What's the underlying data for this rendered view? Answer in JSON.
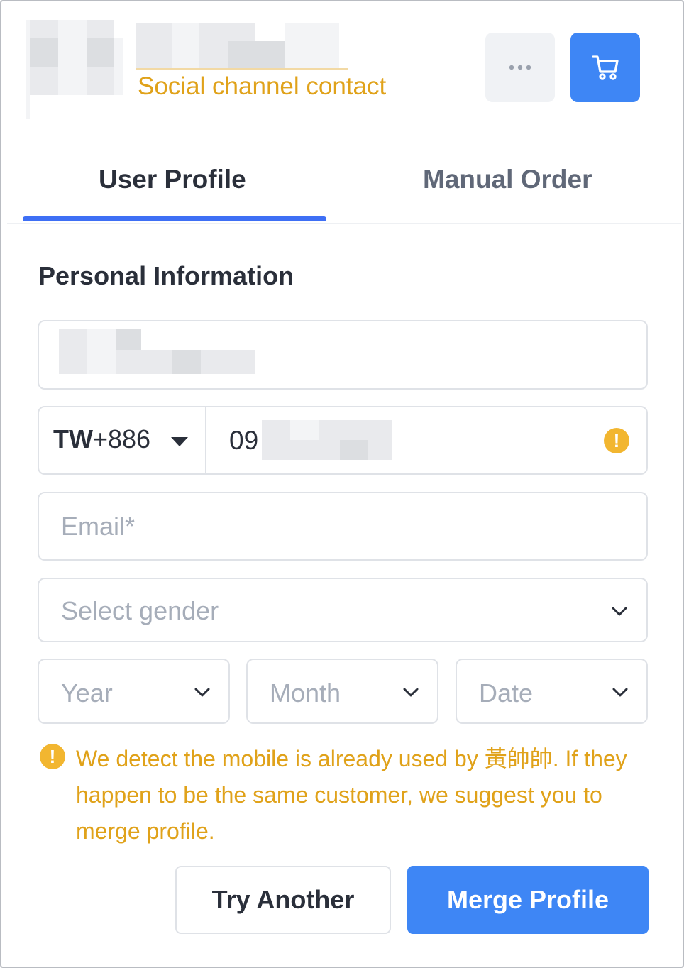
{
  "header": {
    "contact_type": "Social channel contact",
    "more_icon": "ellipsis-icon",
    "cart_icon": "shopping-cart-icon"
  },
  "tabs": [
    {
      "label": "User Profile",
      "active": true
    },
    {
      "label": "Manual Order",
      "active": false
    }
  ],
  "section": {
    "title": "Personal Information"
  },
  "form": {
    "phone": {
      "country_code": "TW",
      "dial_code": "+886",
      "visible_prefix": "09",
      "warning_icon": "exclamation-circle-icon"
    },
    "email": {
      "placeholder": "Email*"
    },
    "gender": {
      "placeholder": "Select gender"
    },
    "birthday": {
      "year_placeholder": "Year",
      "month_placeholder": "Month",
      "date_placeholder": "Date"
    }
  },
  "warning": {
    "message": "We detect the mobile is already used by 黃帥帥. If they happen to be the same customer, we suggest you to merge profile."
  },
  "actions": {
    "try_another": "Try Another",
    "merge_profile": "Merge Profile"
  },
  "colors": {
    "primary": "#3e86f5",
    "tab_underline": "#3e6ff5",
    "warning": "#e0a21a",
    "warning_icon": "#f2b630"
  }
}
